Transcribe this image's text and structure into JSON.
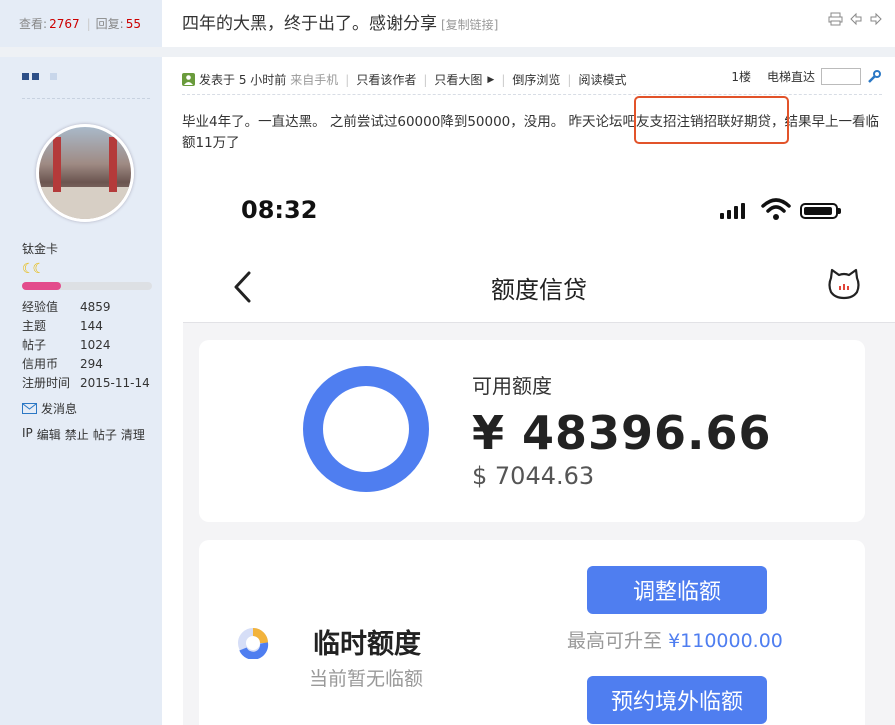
{
  "header": {
    "views_label": "查看:",
    "views_count": "2767",
    "replies_label": "回复:",
    "replies_count": "55",
    "separator": "|",
    "thread_title": "四年的大黑，终于出了。感谢分享",
    "copy_link": "[复制链接]"
  },
  "user": {
    "rank": "钛金卡",
    "level_progress": 0.3,
    "stats": [
      {
        "label": "经验值",
        "value": "4859"
      },
      {
        "label": "主题",
        "value": "144"
      },
      {
        "label": "帖子",
        "value": "1024"
      },
      {
        "label": "信用币",
        "value": "294"
      },
      {
        "label": "注册时间",
        "value": "2015-11-14"
      }
    ],
    "send_message": "发消息",
    "admin_ops": [
      "IP",
      "编辑",
      "禁止",
      "帖子",
      "清理"
    ]
  },
  "post": {
    "posted": "发表于 5 小时前",
    "source": "来自手机",
    "only_author": "只看该作者",
    "only_big_images": "只看大图",
    "reverse": "倒序浏览",
    "reading_mode": "阅读模式",
    "floor": "1楼",
    "jump_label": "电梯直达",
    "body": "毕业4年了。一直达黑。 之前尝试过60000降到50000，没用。 昨天论坛吧友支招注销招联好期贷，结果早上一看临额11万了"
  },
  "screenshot": {
    "time": "08:32",
    "nav_title": "额度信贷",
    "available_label": "可用额度",
    "available_cny": "¥ 48396.66",
    "available_usd": "$ 7044.63",
    "temp_title": "临时额度",
    "temp_sub": "当前暂无临额",
    "adjust_button": "调整临额",
    "max_prefix": "最高可升至",
    "max_amount": "¥110000.00",
    "abroad_button": "预约境外临额",
    "accent": "#4f7ef0"
  },
  "colors": {
    "sidebar_bg": "#e5ecf6",
    "highlight_border": "#e2532a",
    "count_red": "#cc0000"
  },
  "icons": [
    "print-icon",
    "prev-thread-icon",
    "next-thread-icon",
    "user-icon",
    "wrench-icon",
    "envelope-icon",
    "back-chevron-icon",
    "cat-logo-icon",
    "signal-icon",
    "wifi-icon",
    "battery-icon",
    "donut-chart-icon",
    "pie-icon"
  ]
}
